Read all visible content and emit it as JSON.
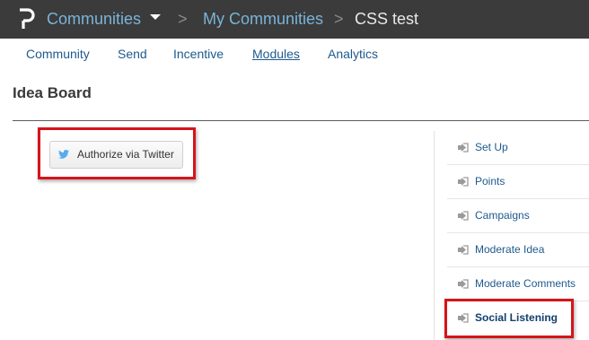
{
  "header": {
    "logo_icon": "brand-p-icon",
    "breadcrumbs": [
      {
        "label": "Communities",
        "has_dropdown": true
      },
      {
        "label": "My Communities"
      },
      {
        "label": "CSS test"
      }
    ],
    "separator": ">"
  },
  "nav": {
    "tabs": [
      {
        "label": "Community"
      },
      {
        "label": "Send"
      },
      {
        "label": "Incentive"
      },
      {
        "label": "Modules",
        "active": true
      },
      {
        "label": "Analytics"
      }
    ]
  },
  "page": {
    "title": "Idea Board"
  },
  "main": {
    "authorize_button": {
      "label": "Authorize via Twitter",
      "icon": "twitter-icon"
    }
  },
  "sidebar": {
    "items": [
      {
        "label": "Set Up",
        "icon": "arrow-right-icon"
      },
      {
        "label": "Points",
        "icon": "arrow-right-icon"
      },
      {
        "label": "Campaigns",
        "icon": "arrow-right-icon"
      },
      {
        "label": "Moderate Idea",
        "icon": "arrow-right-icon"
      },
      {
        "label": "Moderate Comments",
        "icon": "arrow-right-icon"
      },
      {
        "label": "Social Listening",
        "icon": "arrow-right-icon",
        "active": true
      }
    ]
  },
  "colors": {
    "header_bg": "#3b3b3b",
    "link": "#1d5a8e",
    "breadcrumb_link": "#79b4da",
    "highlight_box": "#d6141b",
    "twitter_blue": "#55acee"
  }
}
